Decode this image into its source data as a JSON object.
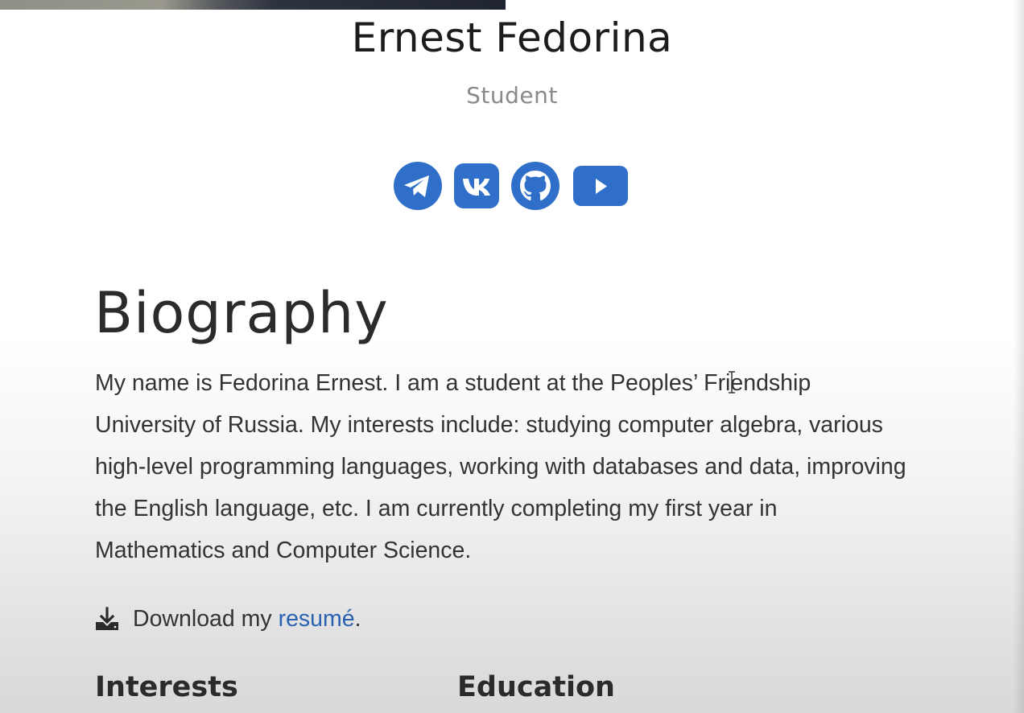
{
  "profile": {
    "name": "Ernest Fedorina",
    "role": "Student"
  },
  "social_links": [
    {
      "name": "telegram-icon",
      "color": "#2f6fc9"
    },
    {
      "name": "vk-icon",
      "color": "#2f6fc9"
    },
    {
      "name": "github-icon",
      "color": "#2f6fc9"
    },
    {
      "name": "youtube-icon",
      "color": "#2f6fc9"
    }
  ],
  "biography": {
    "heading": "Biography",
    "text": "My name is Fedorina Ernest. I am a student at the Peoples’ Friendship University of Russia. My interests include: studying computer algebra, various high-level programming languages, working with databases and data, improving the English language, etc. I am currently completing my first year in Mathematics and Computer Science.",
    "download_prefix": "Download my",
    "download_link": "resumé",
    "download_suffix": ".",
    "download_icon": "download-icon"
  },
  "sections": {
    "interests": "Interests",
    "education": "Education"
  },
  "colors": {
    "accent": "#2f6fc9",
    "link": "#2962b0",
    "text": "#333333",
    "muted": "#8a8a8a"
  }
}
